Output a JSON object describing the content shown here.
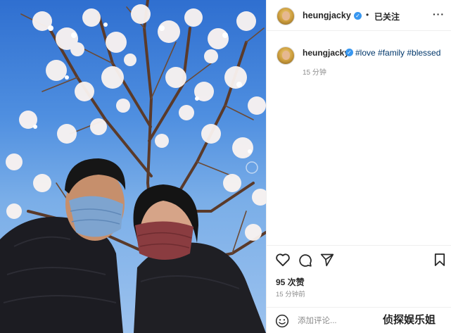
{
  "post": {
    "username": "heungjacky",
    "follow_label": "已关注",
    "dot": "•",
    "more_label": "···",
    "verified_mark": "✓"
  },
  "caption": {
    "username": "heungjacky",
    "hashtags": "#love #family #blessed",
    "time": "15 分钟"
  },
  "engagement": {
    "likes": "95 次赞",
    "posted": "15 分钟前"
  },
  "comment": {
    "placeholder": "添加评论..."
  },
  "watermark": "侦探娱乐姐"
}
